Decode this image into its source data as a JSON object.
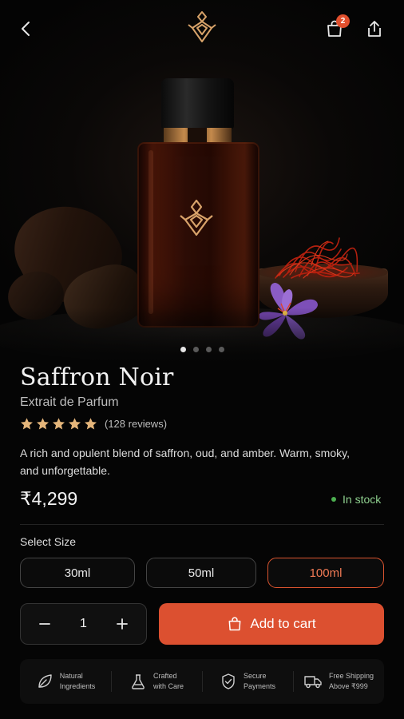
{
  "header": {
    "back_icon": "chevron-left-icon",
    "logo_icon": "brand-logo-icon",
    "cart_icon": "shopping-bag-icon",
    "cart_count": "2",
    "share_icon": "share-icon"
  },
  "gallery": {
    "slide_count": 4,
    "active_slide": 1
  },
  "product": {
    "name": "Saffron Noir",
    "type": "Extrait de Parfum",
    "rating": 5,
    "reviews_text": "(128 reviews)",
    "description": "A rich and opulent blend of saffron, oud, and amber. Warm, smoky, and unforgettable.",
    "price": "₹4,299",
    "stock_status": "In stock"
  },
  "size": {
    "label": "Select Size",
    "options": [
      "30ml",
      "50ml",
      "100ml"
    ],
    "selected": "100ml"
  },
  "quantity": {
    "value": "1",
    "minus_icon": "minus-icon",
    "plus_icon": "plus-icon"
  },
  "cart_button": {
    "label": "Add to cart",
    "icon": "shopping-bag-icon"
  },
  "features": [
    {
      "line1": "Natural",
      "line2": "Ingredients",
      "icon": "leaf-icon"
    },
    {
      "line1": "Crafted",
      "line2": "with Care",
      "icon": "flask-icon"
    },
    {
      "line1": "Secure",
      "line2": "Payments",
      "icon": "shield-check-icon"
    },
    {
      "line1": "Free Shipping",
      "line2": "Above ₹999",
      "icon": "truck-icon"
    }
  ],
  "colors": {
    "accent": "#dc5030",
    "stock_green": "#4caf50",
    "star_gold": "#e4b57a",
    "background": "#050505"
  }
}
